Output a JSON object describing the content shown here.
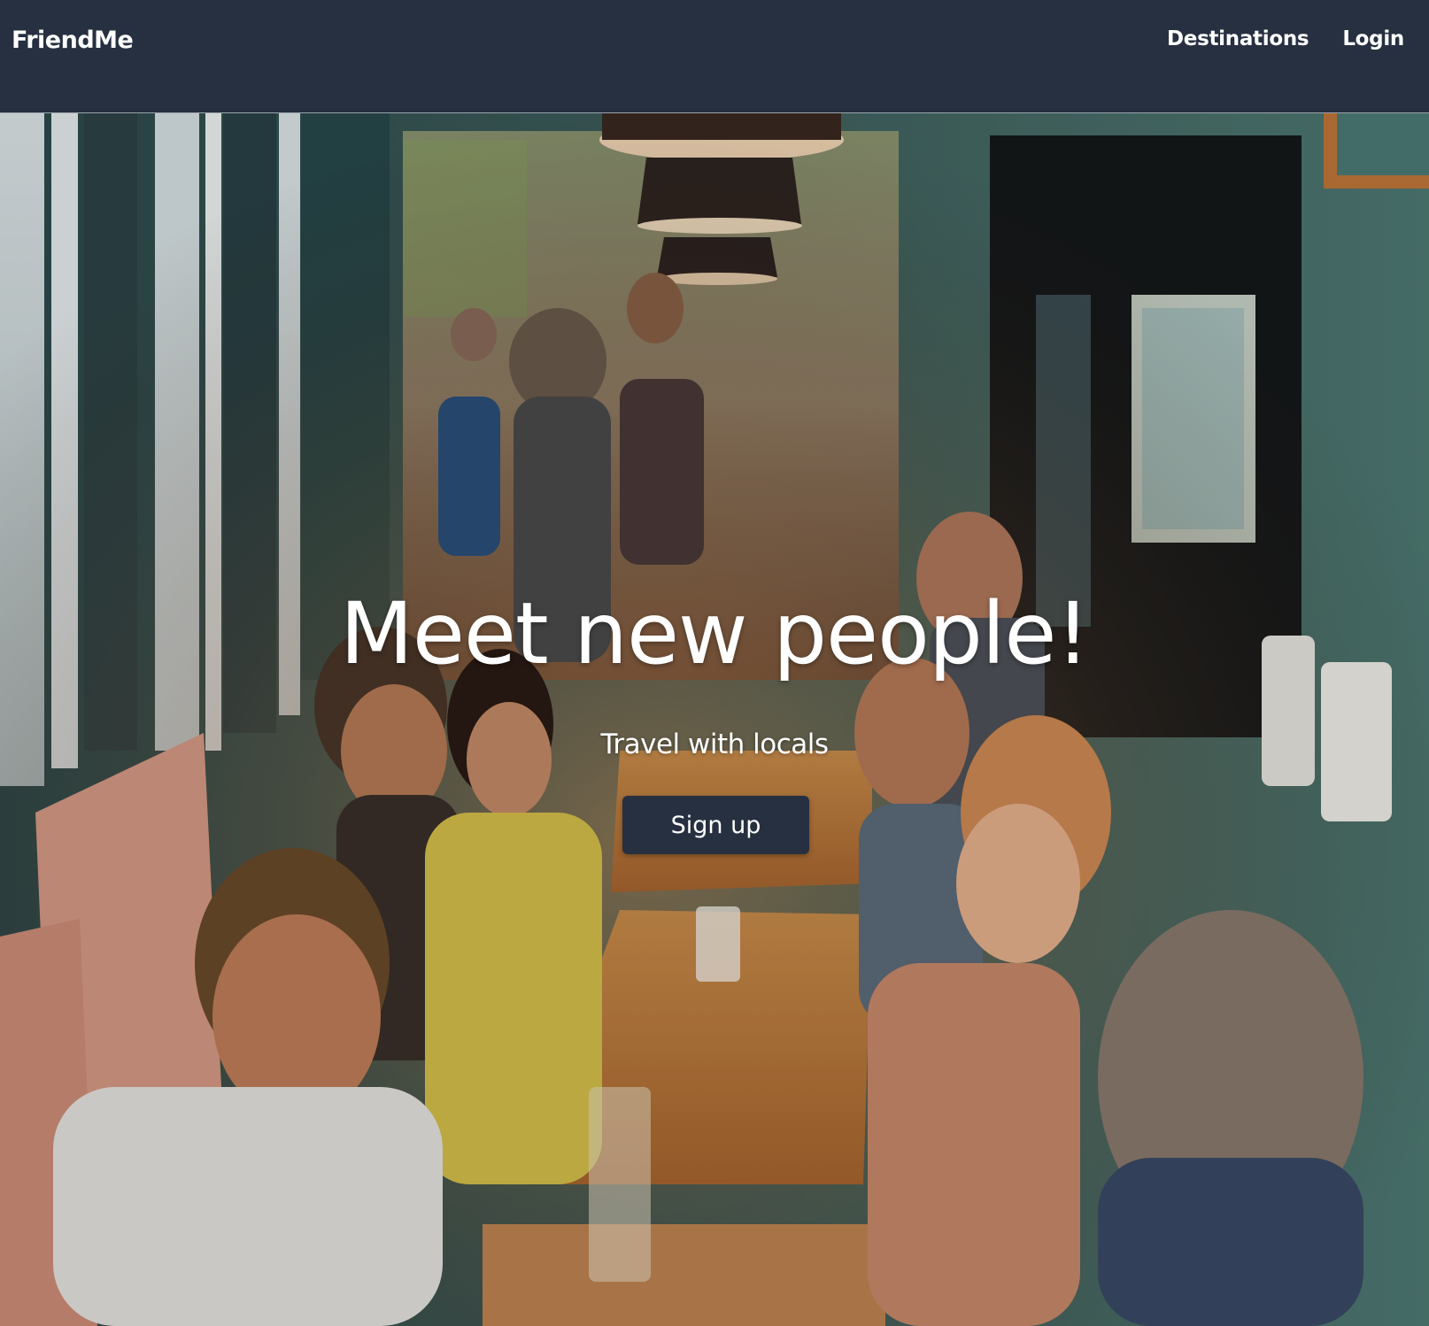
{
  "navbar": {
    "brand": "FriendMe",
    "links": [
      {
        "label": "Destinations"
      },
      {
        "label": "Login"
      }
    ]
  },
  "hero": {
    "title": "Meet new people!",
    "subtitle": "Travel with locals",
    "cta_label": "Sign up",
    "background_image": "photo of people socializing at a restaurant table"
  },
  "colors": {
    "navbar_bg": "#263040",
    "button_bg": "#263040",
    "text": "#ffffff"
  }
}
